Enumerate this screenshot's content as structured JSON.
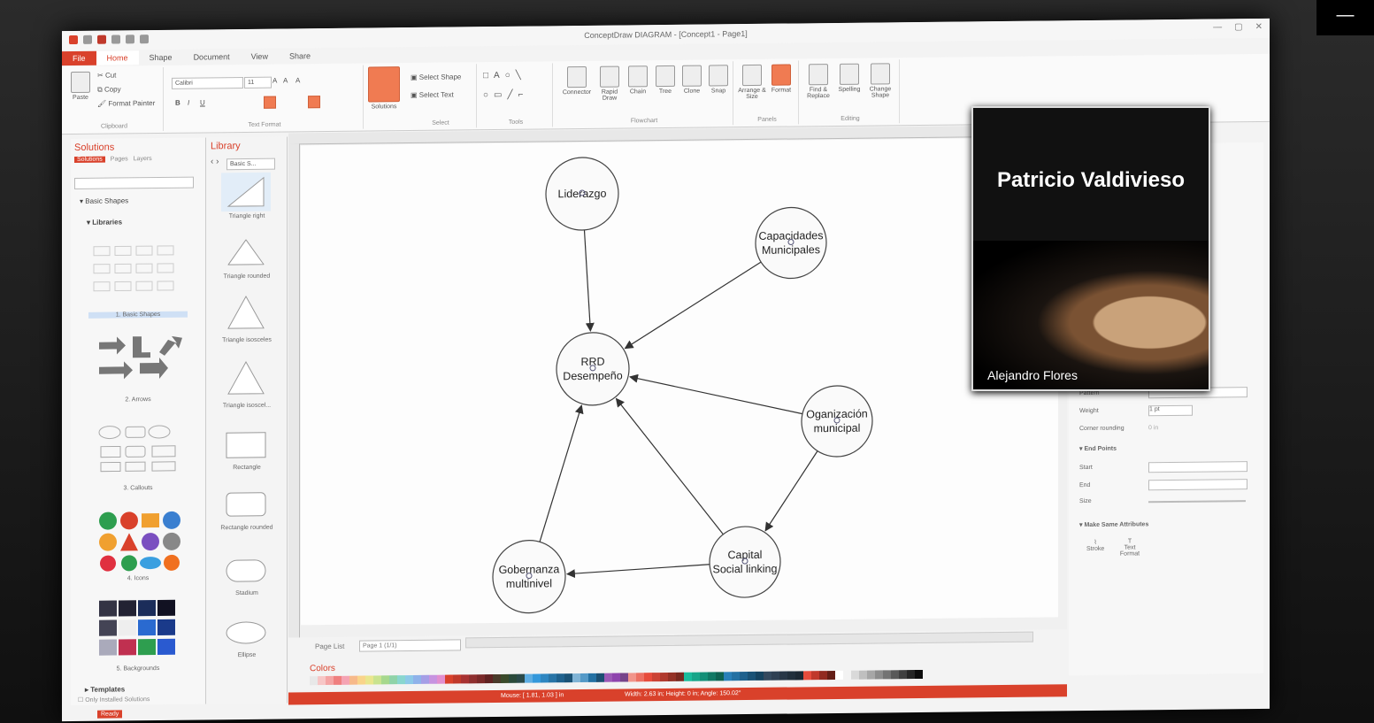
{
  "app": {
    "title": "ConceptDraw DIAGRAM - [Concept1 - Page1]"
  },
  "ribbon": {
    "tabs": [
      "File",
      "Home",
      "Shape",
      "Document",
      "View",
      "Share"
    ],
    "clipboard": {
      "paste": "Paste",
      "cut": "Cut",
      "copy": "Copy",
      "format_painter": "Format Painter",
      "caption": "Clipboard"
    },
    "text_format": {
      "font": "Calibri",
      "size": "11",
      "caption": "Text Format"
    },
    "solutions_btn": "Solutions",
    "select": {
      "select_shape": "Select Shape",
      "select_text": "Select Text",
      "caption": "Select"
    },
    "tools_caption": "Tools",
    "flowchart": {
      "connector": "Connector",
      "rapid_draw": "Rapid Draw",
      "chain": "Chain",
      "tree": "Tree",
      "clone": "Clone",
      "snap": "Snap",
      "caption": "Flowchart"
    },
    "panels": {
      "arrange": "Arrange & Size",
      "format": "Format",
      "caption": "Panels"
    },
    "editing": {
      "find": "Find & Replace",
      "spelling": "Spelling",
      "change_shape": "Change Shape",
      "caption": "Editing"
    }
  },
  "solutions_panel": {
    "title": "Solutions",
    "tabs": [
      "Solutions",
      "Pages",
      "Layers"
    ],
    "tree_basic": "Basic Shapes",
    "tree_libraries": "Libraries",
    "libs": [
      "1. Basic Shapes",
      "2. Arrows",
      "3. Callouts",
      "4. Icons",
      "5. Backgrounds"
    ],
    "templates": "Templates",
    "only_installed": "Only Installed Solutions"
  },
  "library_panel": {
    "title": "Library",
    "selector": "Basic S...",
    "shapes": [
      "Triangle right",
      "Triangle rounded",
      "Triangle isosceles",
      "Triangle isoscel...",
      "Rectangle",
      "Rectangle rounded",
      "Stadium",
      "Ellipse"
    ]
  },
  "diagram": {
    "nodes": [
      {
        "id": "liderazgo",
        "lines": [
          "Liderazgo"
        ]
      },
      {
        "id": "capacidades",
        "lines": [
          "Capacidades",
          "Municipales"
        ]
      },
      {
        "id": "rrd",
        "lines": [
          "RRD",
          "Desempeño"
        ]
      },
      {
        "id": "organizacion",
        "lines": [
          "Oganización",
          "municipal"
        ]
      },
      {
        "id": "capital",
        "lines": [
          "Capital",
          "Social linking"
        ]
      },
      {
        "id": "gobernanza",
        "lines": [
          "Gobernanza",
          "multinivel"
        ]
      }
    ]
  },
  "bottom": {
    "page_list": "Page List",
    "page_selector": "Page 1 (1/1)",
    "colors": "Colors",
    "status_mouse": "Mouse: [ 1.81, 1.03 ] in",
    "status_size": "Width: 2.63 in;  Height: 0 in;  Angle: 150.02°",
    "ready": "Ready"
  },
  "right_panel": {
    "pattern": "Pattern",
    "weight": "Weight",
    "weight_value": "1 pt",
    "corner_rounding": "Corner rounding",
    "corner_value": "0 in",
    "end_points": "End Points",
    "start": "Start",
    "end": "End",
    "size": "Size",
    "make_same": "Make Same Attributes",
    "stroke": "Stroke",
    "text_format": "Text Format"
  },
  "video_call": {
    "title_name": "Patricio Valdivieso",
    "participant": "Alejandro Flores"
  },
  "colors": {
    "accent": "#d9412b",
    "palette": [
      "#e8e8e8",
      "#f7c6c6",
      "#f4a4a4",
      "#ef7f7f",
      "#f5a3b3",
      "#f7b98a",
      "#f9d48a",
      "#e9e68d",
      "#c9e38f",
      "#a6d88d",
      "#8fd3a8",
      "#89d6cf",
      "#8dc9e8",
      "#8fb2ea",
      "#a59ee6",
      "#c793e0",
      "#e28fcf",
      "#d9412b",
      "#c0392b",
      "#a83232",
      "#8e2f2f",
      "#7a2929",
      "#602222",
      "#4a3a2a",
      "#3a4a2a",
      "#2a4a3a",
      "#2a4a4a",
      "#5dade2",
      "#3498db",
      "#2e86c1",
      "#2874a6",
      "#1f618d",
      "#1a5276",
      "#7fb3d5",
      "#5499c7",
      "#2471a3",
      "#1b4f72",
      "#9b59b6",
      "#8e44ad",
      "#76448a",
      "#f1948a",
      "#ec7063",
      "#e74c3c",
      "#cb4335",
      "#b03a2e",
      "#943126",
      "#78281f",
      "#1abc9c",
      "#17a589",
      "#148f77",
      "#117864",
      "#0e6251",
      "#2980b9",
      "#2471a3",
      "#1f618d",
      "#1a5276",
      "#154360",
      "#34495e",
      "#2e4053",
      "#283747",
      "#212f3c",
      "#1c2833",
      "#e74c3c",
      "#c0392b",
      "#922b21",
      "#641e16",
      "#ffffff",
      "#f2f2f2",
      "#d9d9d9",
      "#bfbfbf",
      "#a6a6a6",
      "#8c8c8c",
      "#737373",
      "#595959",
      "#404040",
      "#262626",
      "#0d0d0d"
    ]
  }
}
